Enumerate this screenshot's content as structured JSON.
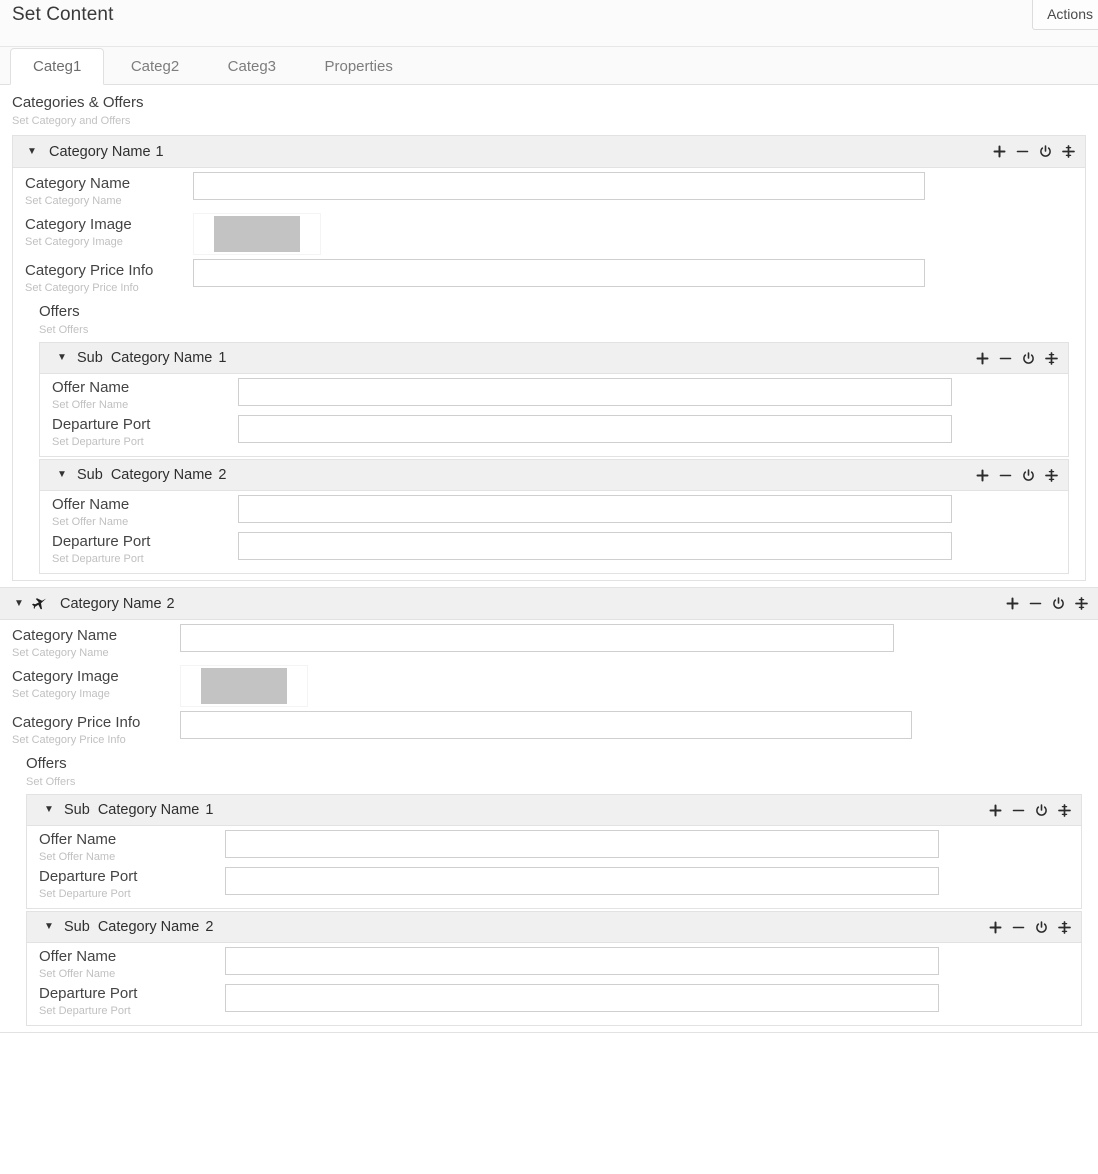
{
  "header": {
    "title": "Set Content",
    "actions_label": "Actions"
  },
  "tabs": [
    {
      "label": "Categ1",
      "active": true
    },
    {
      "label": "Categ2",
      "active": false
    },
    {
      "label": "Categ3",
      "active": false
    },
    {
      "label": "Properties",
      "active": false
    }
  ],
  "section": {
    "title": "Categories & Offers",
    "subtitle": "Set Category and Offers"
  },
  "header_icons": {
    "add": "plus-icon",
    "remove": "minus-icon",
    "power": "power-icon",
    "move": "move-icon"
  },
  "categories": [
    {
      "header_label": "Category Name",
      "header_num": "1",
      "has_plane_icon": false,
      "fields": [
        {
          "label": "Category Name",
          "hint": "Set Category Name",
          "type": "text",
          "value": ""
        },
        {
          "label": "Category Image",
          "hint": "Set Category Image",
          "type": "image",
          "value": ""
        },
        {
          "label": "Category Price Info",
          "hint": "Set Category Price Info",
          "type": "text",
          "value": ""
        }
      ],
      "offers": {
        "title": "Offers",
        "subtitle": "Set Offers",
        "subcategories": [
          {
            "prefix": "Sub",
            "label": "Category Name",
            "num": "1",
            "fields": [
              {
                "label": "Offer Name",
                "hint": "Set Offer Name",
                "value": ""
              },
              {
                "label": "Departure Port",
                "hint": "Set Departure Port",
                "value": ""
              }
            ]
          },
          {
            "prefix": "Sub",
            "label": "Category Name",
            "num": "2",
            "fields": [
              {
                "label": "Offer Name",
                "hint": "Set Offer Name",
                "value": ""
              },
              {
                "label": "Departure Port",
                "hint": "Set Departure Port",
                "value": ""
              }
            ]
          }
        ]
      }
    },
    {
      "header_label": "Category Name",
      "header_num": "2",
      "has_plane_icon": true,
      "fields": [
        {
          "label": "Category Name",
          "hint": "Set Category Name",
          "type": "text",
          "value": ""
        },
        {
          "label": "Category Image",
          "hint": "Set Category Image",
          "type": "image",
          "value": ""
        },
        {
          "label": "Category Price Info",
          "hint": "Set Category Price Info",
          "type": "text",
          "value": ""
        }
      ],
      "offers": {
        "title": "Offers",
        "subtitle": "Set Offers",
        "subcategories": [
          {
            "prefix": "Sub",
            "label": "Category Name",
            "num": "1",
            "fields": [
              {
                "label": "Offer Name",
                "hint": "Set Offer Name",
                "value": ""
              },
              {
                "label": "Departure Port",
                "hint": "Set Departure Port",
                "value": ""
              }
            ]
          },
          {
            "prefix": "Sub",
            "label": "Category Name",
            "num": "2",
            "fields": [
              {
                "label": "Offer Name",
                "hint": "Set Offer Name",
                "value": ""
              },
              {
                "label": "Departure Port",
                "hint": "Set Departure Port",
                "value": ""
              }
            ]
          }
        ]
      }
    }
  ],
  "colors": {
    "header_bg": "#f0f0f0",
    "panel_border": "#e2e2e2",
    "label": "#444444",
    "hint": "#c0c0c0",
    "image_placeholder": "#c3c3c3"
  }
}
